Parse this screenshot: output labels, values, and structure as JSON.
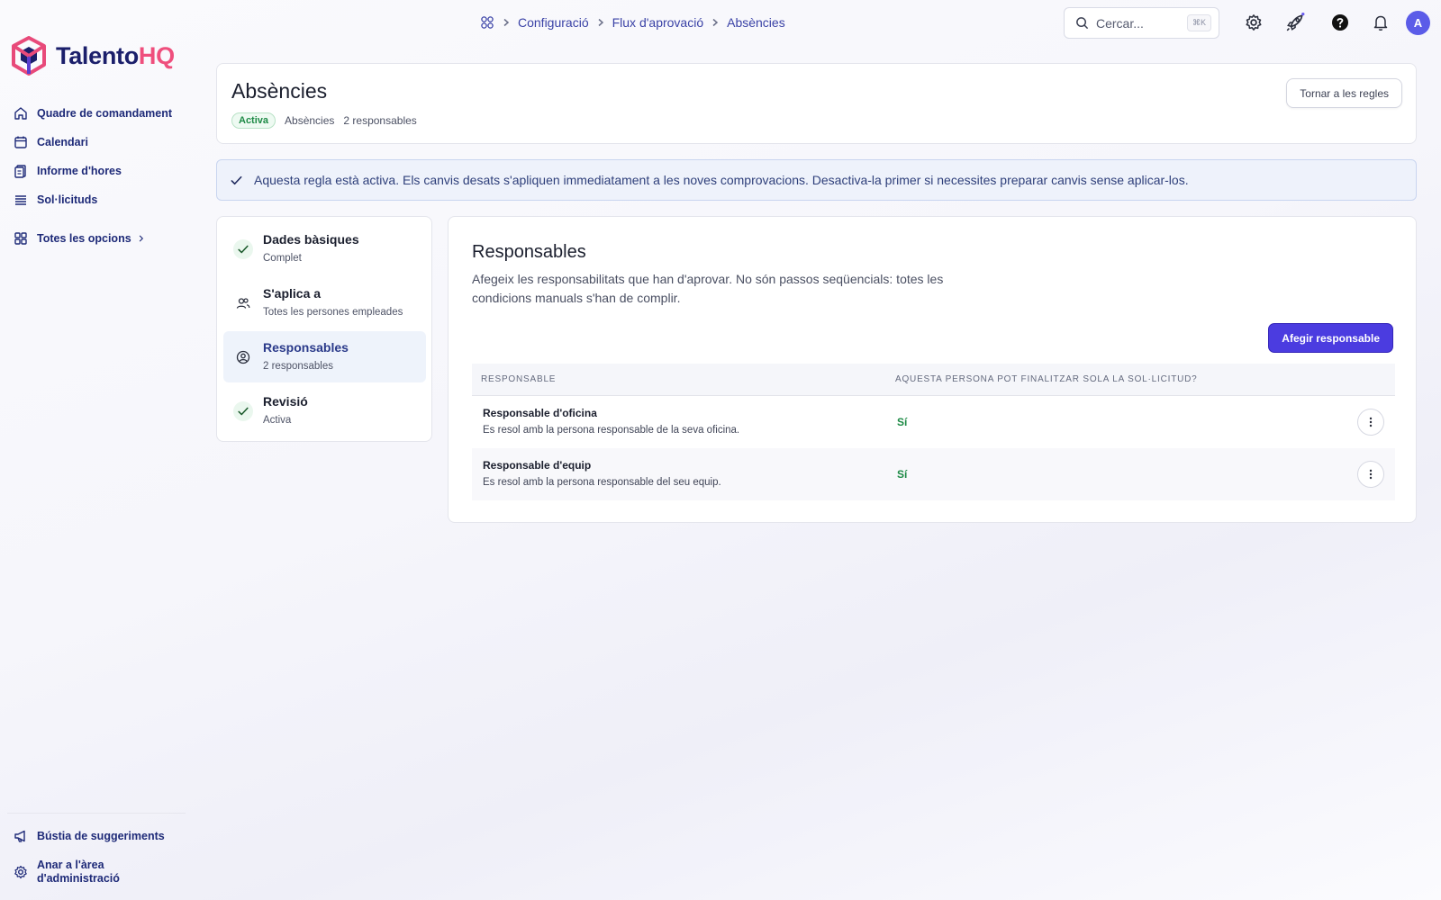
{
  "brand": {
    "name_part1": "Talento",
    "name_part2": "HQ",
    "primary_color": "#1b1f6b",
    "accent_color": "#ef4f7d"
  },
  "sidebar": {
    "items": [
      {
        "label": "Quadre de comandament",
        "icon": "home-icon"
      },
      {
        "label": "Calendari",
        "icon": "calendar-icon"
      },
      {
        "label": "Informe d'hores",
        "icon": "report-icon"
      },
      {
        "label": "Sol·licituds",
        "icon": "list-icon"
      }
    ],
    "all_options_label": "Totes les opcions",
    "bottom": [
      {
        "label": "Bústia de suggeriments",
        "icon": "megaphone-icon"
      },
      {
        "label": "Anar a l'àrea d'administració",
        "icon": "gear-icon"
      }
    ]
  },
  "topbar": {
    "breadcrumb": [
      "Configuració",
      "Flux d'aprovació",
      "Absències"
    ],
    "search_placeholder": "Cercar...",
    "search_shortcut": "⌘K",
    "avatar_initial": "A"
  },
  "header": {
    "title": "Absències",
    "status_badge": "Activa",
    "meta_type": "Absències",
    "meta_count": "2 responsables",
    "back_button": "Tornar a les regles"
  },
  "banner": {
    "text": "Aquesta regla està activa. Els canvis desats s'apliquen immediatament a les noves comprovacions. Desactiva-la primer si necessites preparar canvis sense aplicar-los."
  },
  "steps": [
    {
      "title": "Dades bàsiques",
      "subtitle": "Complet",
      "icon": "check-icon"
    },
    {
      "title": "S'aplica a",
      "subtitle": "Totes les persones empleades",
      "icon": "users-icon"
    },
    {
      "title": "Responsables",
      "subtitle": "2 responsables",
      "icon": "user-circle-icon",
      "active": true
    },
    {
      "title": "Revisió",
      "subtitle": "Activa",
      "icon": "check-icon"
    }
  ],
  "main": {
    "title": "Responsables",
    "description": "Afegeix les responsabilitats que han d'aprovar. No són passos seqüencials: totes les condicions manuals s'han de complir.",
    "add_button": "Afegir responsable",
    "columns": [
      "RESPONSABLE",
      "AQUESTA PERSONA POT FINALITZAR SOLA LA SOL·LICITUD?"
    ],
    "rows": [
      {
        "title": "Responsable d'oficina",
        "subtitle": "Es resol amb la persona responsable de la seva oficina.",
        "value": "Sí"
      },
      {
        "title": "Responsable d'equip",
        "subtitle": "Es resol amb la persona responsable del seu equip.",
        "value": "Sí"
      }
    ]
  }
}
